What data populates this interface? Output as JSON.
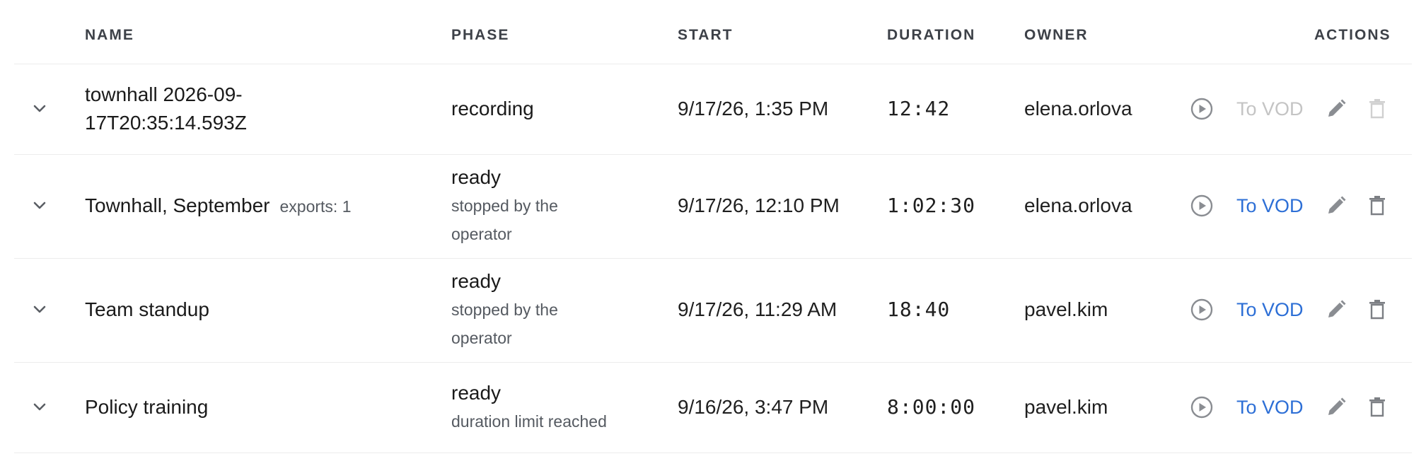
{
  "columns": {
    "name": "NAME",
    "phase": "PHASE",
    "start": "START",
    "duration": "DURATION",
    "owner": "OWNER",
    "actions": "ACTIONS"
  },
  "rows": [
    {
      "name_line1": "townhall 2026-09-",
      "name_line2": "17T20:35:14.593Z",
      "phase": "recording",
      "start": "9/17/26, 1:35 PM",
      "duration": "12:42",
      "owner": "elena.orlova",
      "vod_label": "To VOD",
      "vod_enabled": false,
      "delete_enabled": false
    },
    {
      "name": "Townhall, September",
      "badge": "exports: 1",
      "phase": "ready",
      "phase_detail_line1": "stopped by the",
      "phase_detail_line2": "operator",
      "start": "9/17/26, 12:10 PM",
      "duration": "1:02:30",
      "owner": "elena.orlova",
      "vod_label": "To VOD",
      "vod_enabled": true,
      "delete_enabled": true
    },
    {
      "name": "Team standup",
      "phase": "ready",
      "phase_detail_line1": "stopped by the",
      "phase_detail_line2": "operator",
      "start": "9/17/26, 11:29 AM",
      "duration": "18:40",
      "owner": "pavel.kim",
      "vod_label": "To VOD",
      "vod_enabled": true,
      "delete_enabled": true
    },
    {
      "name": "Policy training",
      "phase": "ready",
      "phase_detail": "duration limit reached",
      "start": "9/16/26, 3:47 PM",
      "duration": "8:00:00",
      "owner": "pavel.kim",
      "vod_label": "To VOD",
      "vod_enabled": true,
      "delete_enabled": true
    }
  ],
  "icons": {
    "expand": "chevron-down-icon",
    "play": "play-circle-icon",
    "edit": "pencil-icon",
    "delete": "trash-icon"
  },
  "colors": {
    "link": "#2d6fd6",
    "disabled": "#c4c4c4",
    "icon": "#8a8d92",
    "header_text": "#3d4148",
    "muted_text": "#555a61"
  }
}
